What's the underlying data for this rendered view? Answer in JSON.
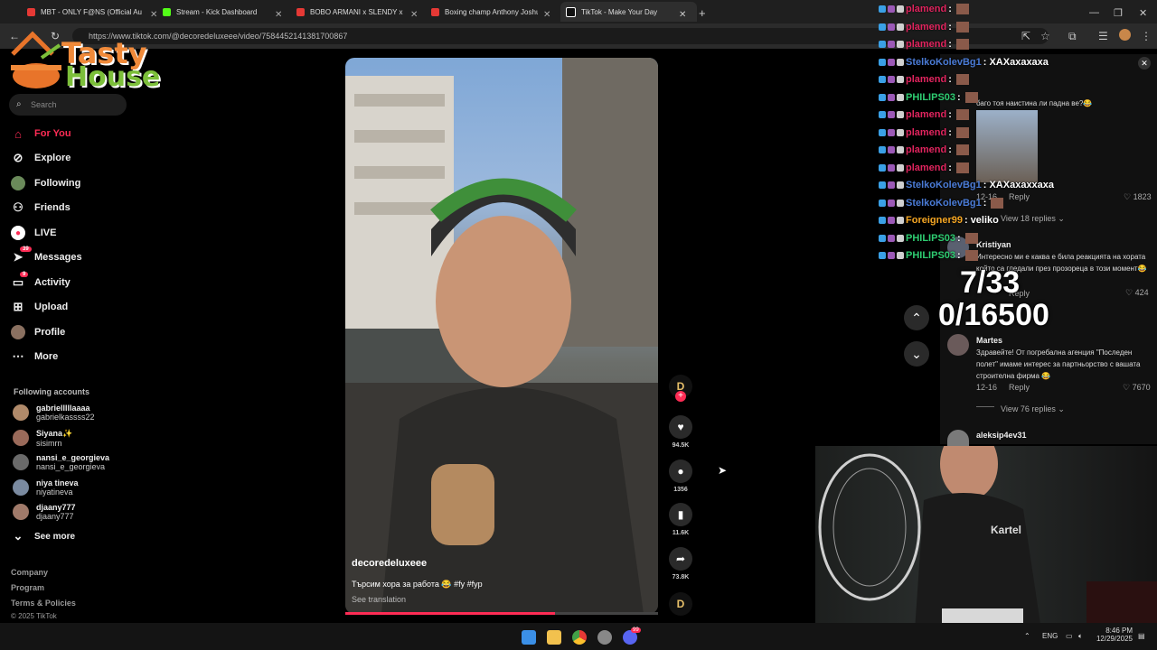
{
  "browser": {
    "tabs": [
      {
        "label": "MBT - ONLY F@NS (Official Au",
        "color": "#e53935"
      },
      {
        "label": "Stream - Kick Dashboard",
        "color": "#53fc18"
      },
      {
        "label": "BOBO ARMANI x SLENDY x PAI",
        "color": "#e53935"
      },
      {
        "label": "Boxing champ Anthony Joshua",
        "color": "#e53935"
      },
      {
        "label": "TikTok - Make Your Day",
        "color": "#ffffff",
        "active": true
      }
    ],
    "url": "https://www.tiktok.com/@decoredeluxeee/video/7584452141381700867"
  },
  "overlay": {
    "logo_line1": "Tasty",
    "logo_line2": "House"
  },
  "sidebar": {
    "search_placeholder": "Search",
    "items": [
      {
        "label": "For You"
      },
      {
        "label": "Explore"
      },
      {
        "label": "Following"
      },
      {
        "label": "Friends"
      },
      {
        "label": "LIVE"
      },
      {
        "label": "Messages",
        "badge": "39"
      },
      {
        "label": "Activity",
        "badge": "9"
      },
      {
        "label": "Upload"
      },
      {
        "label": "Profile"
      },
      {
        "label": "More"
      }
    ],
    "following_title": "Following accounts",
    "accounts": [
      {
        "name": "gabrielllllaaaa",
        "handle": "gabrielkassss22"
      },
      {
        "name": "Siyana✨",
        "handle": "sisimrn"
      },
      {
        "name": "nansi_e_georgieva",
        "handle": "nansi_e_georgieva"
      },
      {
        "name": "niya tineva",
        "handle": "niyatineva"
      },
      {
        "name": "djaany777",
        "handle": "djaany777"
      }
    ],
    "see_more": "See more",
    "footer": [
      "Company",
      "Program",
      "Terms & Policies",
      "© 2025 TikTok"
    ]
  },
  "video": {
    "author": "decoredeluxeee",
    "caption": "Търсим хора за работа 😂 #fy #fyp",
    "translate": "See translation",
    "progress": 0.67,
    "likes": "94.5K",
    "comments": "1356",
    "saves": "11.6K",
    "shares": "73.8K"
  },
  "chat": [
    {
      "user": "plamend",
      "msg": ":",
      "color": "#e0245e"
    },
    {
      "user": "plamend",
      "msg": ":",
      "color": "#e0245e"
    },
    {
      "user": "plamend",
      "msg": ":",
      "color": "#e0245e"
    },
    {
      "user": "StelkoKolevBg1",
      "msg": ": XAXaxaxaxa",
      "color": "#4a7bd6"
    },
    {
      "user": "plamend",
      "msg": ":",
      "color": "#e0245e"
    },
    {
      "user": "PHILIPS03",
      "msg": ":",
      "color": "#2ecc71"
    },
    {
      "user": "plamend",
      "msg": ":",
      "color": "#e0245e"
    },
    {
      "user": "plamend",
      "msg": ":",
      "color": "#e0245e"
    },
    {
      "user": "plamend",
      "msg": ":",
      "color": "#e0245e"
    },
    {
      "user": "plamend",
      "msg": ":",
      "color": "#e0245e"
    },
    {
      "user": "StelkoKolevBg1",
      "msg": ": XAXaxaxxaxa",
      "color": "#4a7bd6"
    },
    {
      "user": "StelkoKolevBg1",
      "msg": ":",
      "color": "#4a7bd6"
    },
    {
      "user": "Foreigner99",
      "msg": ": veliko",
      "color": "#f5a623"
    },
    {
      "user": "PHILIPS03",
      "msg": ":",
      "color": "#2ecc71"
    },
    {
      "user": "PHILIPS03",
      "msg": ":",
      "color": "#2ecc71"
    }
  ],
  "comments": {
    "c1_text": "баго тоя наистина ли падна ве?😂",
    "c1_date": "12-16",
    "c1_reply": "Reply",
    "c1_likes": "1823",
    "c1_view": "View 18 replies",
    "c2_name": "Kristiyan",
    "c2_text": "Интересно ми е каква е била реакцията на хората който са гледали през прозореца в този момент😂",
    "c2_reply": "Reply",
    "c2_likes": "424",
    "c3_name": "Martes",
    "c3_text": "Здравейте! От погребална агенция \"Последен полет\" имаме интерес за партньорство с вашата строителна фирма 😂",
    "c3_date": "12-16",
    "c3_reply": "Reply",
    "c3_likes": "7670",
    "c3_view": "View 76 replies",
    "c4_name": "aleksip4ev31"
  },
  "counters": {
    "line1": "7/33",
    "line2": "0/16500"
  },
  "cam": {
    "shirt_text": "Kartel"
  },
  "taskbar": {
    "lang": "ENG",
    "time": "8:46 PM",
    "date": "12/29/2025",
    "discord_badge": "99"
  }
}
